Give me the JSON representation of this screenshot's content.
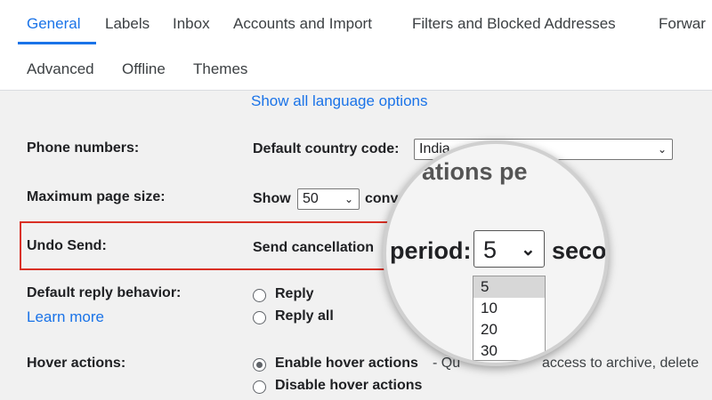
{
  "tabs": {
    "row1": [
      "General",
      "Labels",
      "Inbox",
      "Accounts and Import",
      "Filters and Blocked Addresses",
      "Forwar"
    ],
    "row2": [
      "Advanced",
      "Offline",
      "Themes"
    ]
  },
  "language": {
    "link": "Show all language options"
  },
  "phone": {
    "label": "Phone numbers:",
    "prefix": "Default country code:",
    "selected": "India"
  },
  "page_size": {
    "label": "Maximum page size:",
    "prefix": "Show",
    "selected": "50",
    "suffix": "conve"
  },
  "undo_send": {
    "label": "Undo Send:",
    "prefix": "Send cancellation"
  },
  "reply": {
    "label": "Default reply behavior:",
    "learn_more": "Learn more",
    "options": [
      "Reply",
      "Reply all"
    ]
  },
  "hover": {
    "label": "Hover actions:",
    "options": [
      "Enable hover actions",
      "Disable hover actions"
    ],
    "enable_desc": "- Qu",
    "enable_desc_tail": "access to archive, delete"
  },
  "magnifier": {
    "top_text": "ations pe",
    "period_label": "period:",
    "selected": "5",
    "suffix": "seco",
    "options": [
      "5",
      "10",
      "20",
      "30"
    ]
  },
  "colors": {
    "accent": "#1a73e8",
    "highlight": "#d93025"
  }
}
